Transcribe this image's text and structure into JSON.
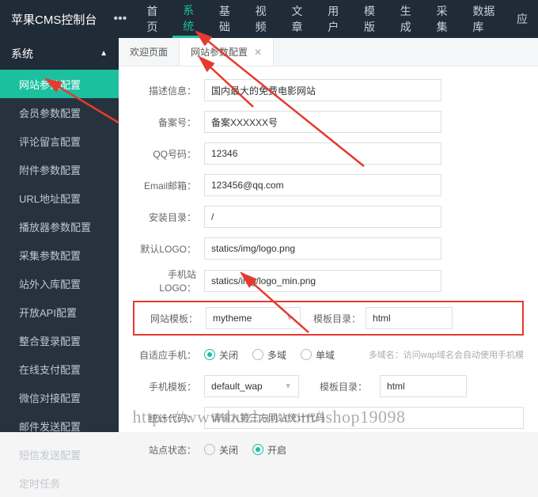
{
  "brand": "苹果CMS控制台",
  "topnav": [
    "首页",
    "系统",
    "基础",
    "视频",
    "文章",
    "用户",
    "模版",
    "生成",
    "采集",
    "数据库",
    "应"
  ],
  "topnav_active": 1,
  "sidebar": {
    "group": "系统",
    "items": [
      "网站参数配置",
      "会员参数配置",
      "评论留言配置",
      "附件参数配置",
      "URL地址配置",
      "播放器参数配置",
      "采集参数配置",
      "站外入库配置",
      "开放API配置",
      "整合登录配置",
      "在线支付配置",
      "微信对接配置",
      "邮件发送配置",
      "短信发送配置",
      "定时任务"
    ],
    "active": 0
  },
  "tabs": [
    {
      "label": "欢迎页面",
      "closable": false
    },
    {
      "label": "网站参数配置",
      "closable": true
    }
  ],
  "tabs_active": 1,
  "form": {
    "desc": {
      "label": "描述信息：",
      "value": "国内最大的免费电影网站"
    },
    "icp": {
      "label": "备案号：",
      "value": "备案XXXXXX号"
    },
    "qq": {
      "label": "QQ号码：",
      "value": "12346"
    },
    "email": {
      "label": "Email邮箱：",
      "value": "123456@qq.com"
    },
    "install": {
      "label": "安装目录：",
      "value": "/"
    },
    "logo": {
      "label": "默认LOGO：",
      "value": "statics/img/logo.png"
    },
    "mlogo": {
      "label": "手机站LOGO：",
      "value": "statics/img/logo_min.png"
    },
    "tpl": {
      "label": "网站模板：",
      "value": "mytheme",
      "dir_label": "模板目录：",
      "dir_value": "html"
    },
    "adapt": {
      "label": "自适应手机：",
      "options": [
        "关闭",
        "多域",
        "单域"
      ],
      "checked": 0,
      "note": "多域名：访问wap域名会自动使用手机模"
    },
    "mtpl": {
      "label": "手机模板：",
      "value": "default_wap",
      "dir_label": "模板目录：",
      "dir_value": "html"
    },
    "stats": {
      "label": "统计代码：",
      "placeholder": "请输入第三方网站统计代码"
    },
    "status": {
      "label": "站点状态：",
      "options": [
        "关闭",
        "开启"
      ],
      "checked": 1
    }
  },
  "watermark": "https://www.huzhan.com/ishop19098"
}
